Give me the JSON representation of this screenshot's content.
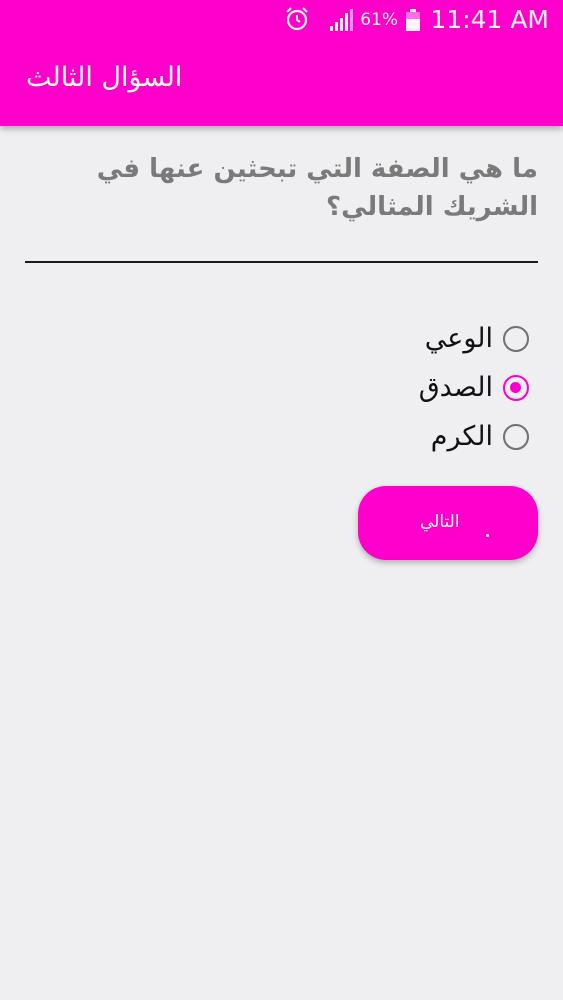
{
  "status_bar": {
    "time": "11:41 AM",
    "battery_percent": "61%",
    "icons": [
      "alarm-icon",
      "signal-icon",
      "battery-icon"
    ]
  },
  "toolbar": {
    "title": "السؤال الثالث"
  },
  "question": {
    "text": "ما هي الصفة التي تبحثين عنها في الشريك المثالي؟"
  },
  "options": [
    {
      "label": "الوعي",
      "selected": false
    },
    {
      "label": "الصدق",
      "selected": true
    },
    {
      "label": "الكرم",
      "selected": false
    }
  ],
  "next_button": {
    "label": "التالي"
  },
  "colors": {
    "accent": "#ff00cc",
    "background": "#efeef0",
    "question_text": "#7a7a7a"
  }
}
